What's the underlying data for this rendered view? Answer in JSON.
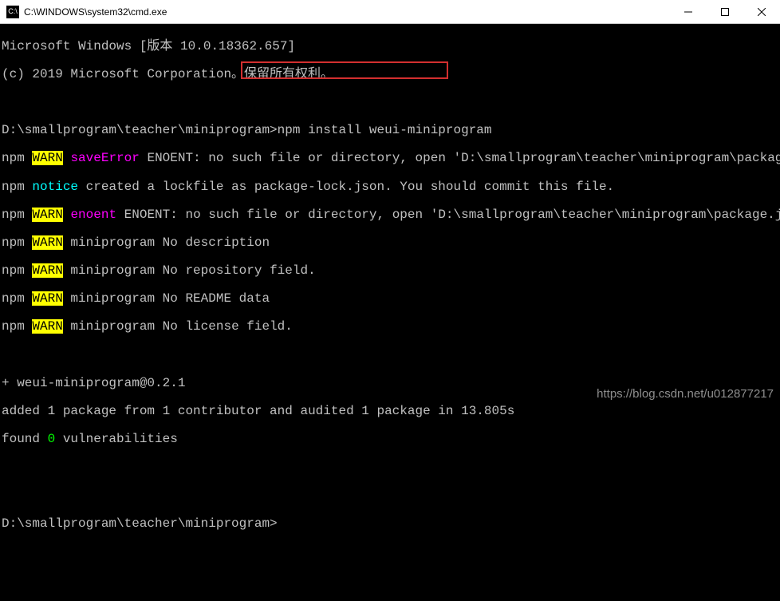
{
  "titlebar": {
    "title": "C:\\WINDOWS\\system32\\cmd.exe"
  },
  "header": {
    "line1": "Microsoft Windows [版本 10.0.18362.657]",
    "line2": "(c) 2019 Microsoft Corporation。保留所有权利。"
  },
  "prompt1": {
    "path": "D:\\smallprogram\\teacher\\miniprogram>",
    "cmd": "npm install weui-miniprogram"
  },
  "npm": {
    "label": "npm",
    "warn": "WARN",
    "notice": "notice",
    "saveError": "saveError",
    "enoent": "enoent",
    "l1_rest": " ENOENT: no such file or directory, open 'D:\\smallprogram\\teacher\\miniprogram\\package.json'",
    "l2_rest": " created a lockfile as package-lock.json. You should commit this file.",
    "l3_rest": " ENOENT: no such file or directory, open 'D:\\smallprogram\\teacher\\miniprogram\\package.json'",
    "l4_rest": " miniprogram No description",
    "l5_rest": " miniprogram No repository field.",
    "l6_rest": " miniprogram No README data",
    "l7_rest": " miniprogram No license field."
  },
  "result": {
    "pkg": "+ weui-miniprogram@0.2.1",
    "added": "added 1 package from 1 contributor and audited 1 package in 13.805s",
    "found_pre": "found ",
    "found_num": "0",
    "found_post": " vulnerabilities"
  },
  "prompt2": {
    "path": "D:\\smallprogram\\teacher\\miniprogram>"
  },
  "watermark": "https://blog.csdn.net/u012877217"
}
